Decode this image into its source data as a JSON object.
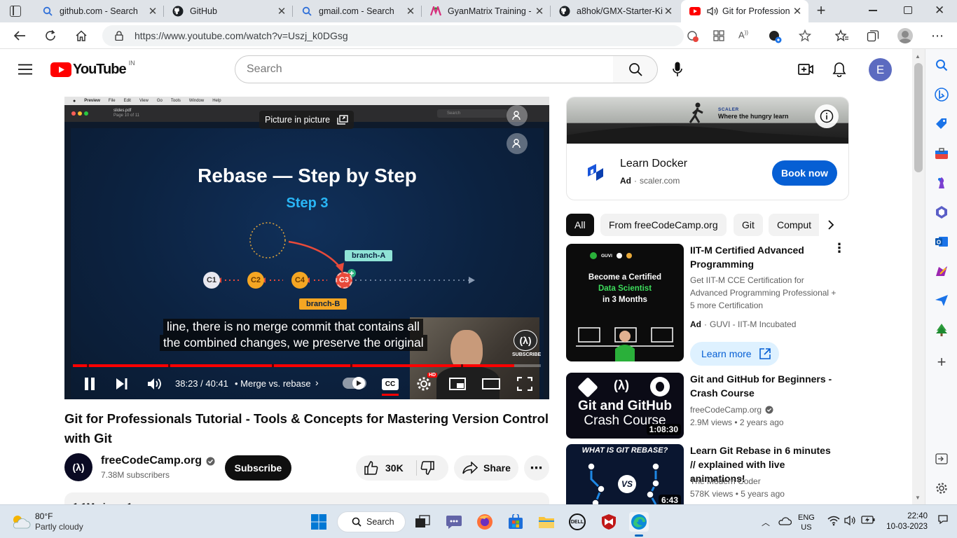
{
  "browser": {
    "tabs": [
      {
        "title": "github.com - Search",
        "icon": "search-icon"
      },
      {
        "title": "GitHub",
        "icon": "github-icon"
      },
      {
        "title": "gmail.com - Search",
        "icon": "search-icon"
      },
      {
        "title": "GyanMatrix Training -",
        "icon": "gyanmatrix-icon"
      },
      {
        "title": "a8hok/GMX-Starter-Ki",
        "icon": "github-icon"
      },
      {
        "title": "Git for Profession",
        "icon": "youtube-icon",
        "active": true
      }
    ],
    "url": "https://www.youtube.com/watch?v=Uszj_k0DGsg"
  },
  "youtube": {
    "logo_text": "YouTube",
    "region": "IN",
    "search_placeholder": "Search",
    "avatar_letter": "E"
  },
  "player": {
    "tooltip": "Picture in picture",
    "slide_title": "Rebase — Step by Step",
    "slide_subtitle": "Step 3",
    "commits": [
      "C1",
      "C2",
      "C4",
      "C3"
    ],
    "branch_a": "branch-A",
    "branch_b": "branch-B",
    "caption_line1": "line, there is no merge commit that contains all",
    "caption_line2": "the combined changes, we preserve the original",
    "facecam_badge": "SUBSCRIBE",
    "time": "38:23 / 40:41",
    "chapter": "• Merge vs. rebase",
    "progress": 0.943,
    "mac_file": "slides.pdf",
    "mac_page": "Page 10 of 11",
    "mac_menu": [
      "Preview",
      "File",
      "Edit",
      "View",
      "Go",
      "Tools",
      "Window",
      "Help"
    ],
    "mac_search": "Search",
    "hd_badge": "HD"
  },
  "video_info": {
    "title": "Git for Professionals Tutorial - Tools & Concepts for Mastering Version Control with Git",
    "channel": "freeCodeCamp.org",
    "subscribers": "7.38M subscribers",
    "subscribe_label": "Subscribe",
    "likes": "30K",
    "share_label": "Share",
    "desc_peek": "1.1M views  1"
  },
  "ad_card": {
    "banner_brand": "SCALER",
    "banner_tagline": "Where the hungry learn",
    "title": "Learn Docker",
    "ad_label": "Ad",
    "domain": "scaler.com",
    "cta": "Book now"
  },
  "chips": [
    "All",
    "From freeCodeCamp.org",
    "Git",
    "Comput"
  ],
  "recommendations": [
    {
      "title": "IIT-M Certified Advanced Programming",
      "desc": "Get IIT-M CCE Certification for Advanced Programming Professional + 5 more Certification",
      "ad_label": "Ad",
      "advertiser": "GUVI - IIT-M Incubated",
      "cta": "Learn more",
      "thumb_line1": "Become a Certified",
      "thumb_line2": "Data Scientist",
      "thumb_line3": "in 3 Months",
      "thumb_brand": "GUVI"
    },
    {
      "title": "Git and GitHub for Beginners - Crash Course",
      "channel": "freeCodeCamp.org",
      "meta": "2.9M views  •  2 years ago",
      "duration": "1:08:30",
      "thumb_line1": "Git and GitHub",
      "thumb_line2": "Crash Course"
    },
    {
      "title": "Learn Git Rebase in 6 minutes // explained with live animations!",
      "channel": "The Modern Coder",
      "meta": "578K views  •  5 years ago",
      "duration": "6:43",
      "thumb_line1": "WHAT IS GIT REBASE?",
      "thumb_vs": "VS"
    }
  ],
  "taskbar": {
    "temp": "80°F",
    "weather": "Partly cloudy",
    "search_label": "Search",
    "lang1": "ENG",
    "lang2": "US",
    "time": "22:40",
    "date": "10-03-2023"
  },
  "colors": {
    "yt_red": "#ff0000",
    "accent_blue": "#065fd4",
    "ad_cta": "#065fd4"
  }
}
